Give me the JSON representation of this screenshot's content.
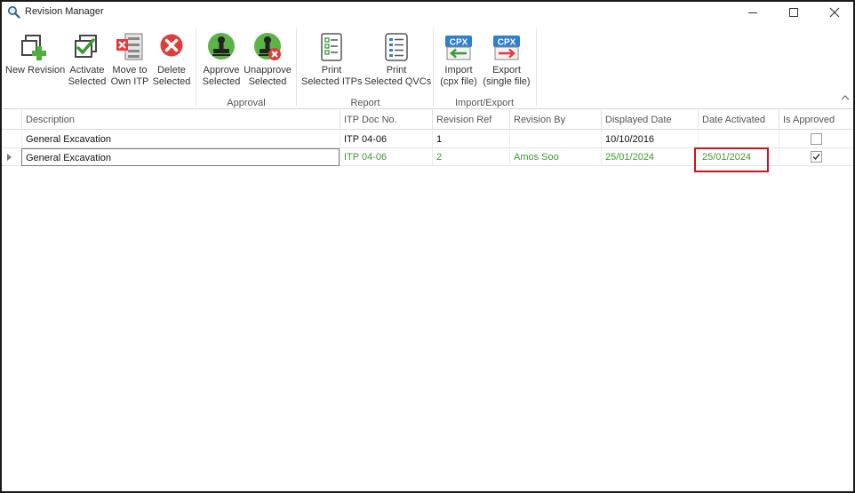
{
  "window": {
    "title": "Revision Manager",
    "icon": "magnifier-icon",
    "controls": [
      "minimize-icon",
      "maximize-icon",
      "close-icon"
    ]
  },
  "ribbon": {
    "buttons": [
      {
        "id": "new-revision",
        "lines": [
          "New Revision"
        ],
        "icon": "new-revision-icon"
      },
      {
        "id": "activate-selected",
        "lines": [
          "Activate",
          "Selected"
        ],
        "icon": "activate-icon"
      },
      {
        "id": "move-to-own-itp",
        "lines": [
          "Move to",
          "Own ITP"
        ],
        "icon": "move-to-own-itp-icon"
      },
      {
        "id": "delete-selected",
        "lines": [
          "Delete",
          "Selected"
        ],
        "icon": "delete-icon"
      },
      {
        "id": "approve-selected",
        "lines": [
          "Approve",
          "Selected"
        ],
        "icon": "approve-stamp-icon"
      },
      {
        "id": "unapprove-selected",
        "lines": [
          "Unapprove",
          "Selected"
        ],
        "icon": "unapprove-stamp-icon"
      },
      {
        "id": "print-selected-itps",
        "lines": [
          "Print",
          "Selected ITPs"
        ],
        "icon": "print-itp-icon"
      },
      {
        "id": "print-selected-qvcs",
        "lines": [
          "Print",
          "Selected QVCs"
        ],
        "icon": "print-qvc-icon"
      },
      {
        "id": "import-cpx",
        "lines": [
          "Import",
          "(cpx file)"
        ],
        "icon": "cpx-import-icon"
      },
      {
        "id": "export-single",
        "lines": [
          "Export",
          "(single file)"
        ],
        "icon": "cpx-export-icon"
      }
    ],
    "groups": [
      "Approval",
      "Report",
      "Import/Export"
    ],
    "cpx_badge": "CPX",
    "colors": {
      "green": "#4caf3c",
      "red": "#e03a3a",
      "blue": "#2f7fd1"
    }
  },
  "grid": {
    "columns": [
      "Description",
      "ITP Doc No.",
      "Revision Ref",
      "Revision By",
      "Displayed Date",
      "Date Activated",
      "Is Approved"
    ],
    "rows": [
      {
        "description": "General Excavation",
        "itp_doc_no": "ITP 04-06",
        "revision_ref": "1",
        "revision_by": "",
        "displayed_date": "10/10/2016",
        "date_activated": "",
        "is_approved": false
      },
      {
        "description": "General Excavation",
        "itp_doc_no": "ITP 04-06",
        "revision_ref": "2",
        "revision_by": "Amos Soo",
        "displayed_date": "25/01/2024",
        "date_activated": "25/01/2024",
        "is_approved": true
      }
    ],
    "active_row_color": "#3c9a2e",
    "highlight_color": "#d0121b"
  }
}
